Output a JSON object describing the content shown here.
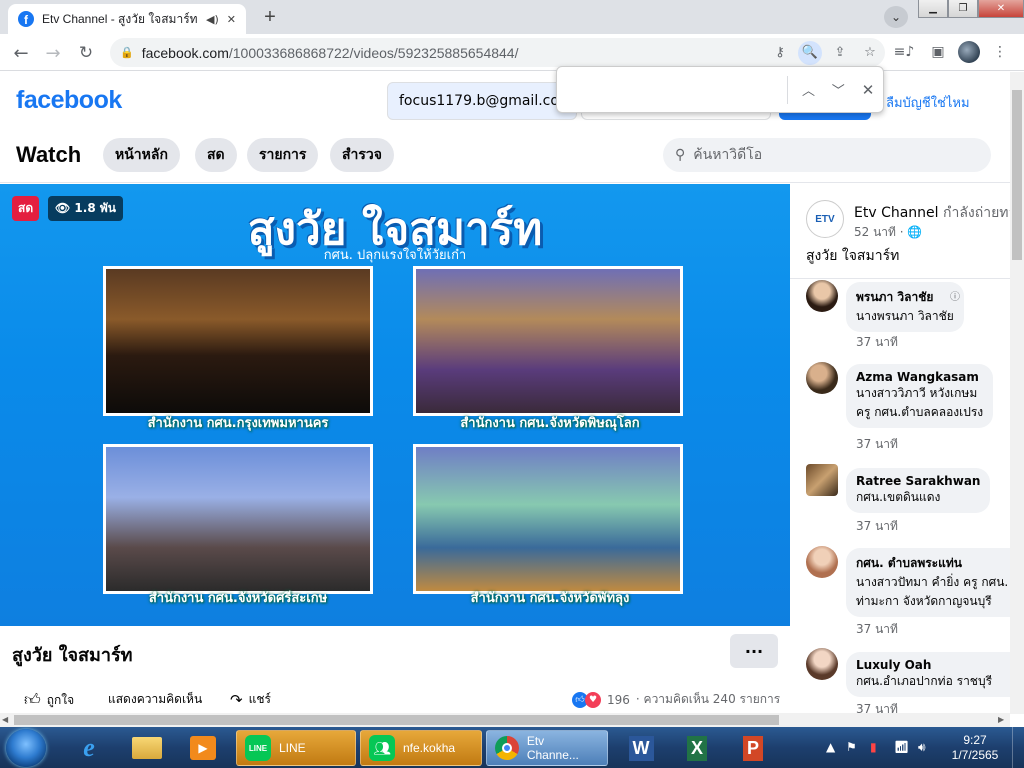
{
  "browser": {
    "tab_title": "Etv Channel - สูงวัย ใจสมาร์ท",
    "url_host": "facebook.com",
    "url_path": "/100033686868722/videos/592325885654844/",
    "find_value": ""
  },
  "fb": {
    "logo": "facebook",
    "email_value": "focus1179.b@gmail.com",
    "forgot_text": "ลืมบัญชีใช่ไหม"
  },
  "watch": {
    "title": "Watch",
    "tabs": [
      "หน้าหลัก",
      "สด",
      "รายการ",
      "สำรวจ"
    ],
    "search_placeholder": "ค้นหาวิดีโอ"
  },
  "video": {
    "live_badge": "สด",
    "views": "1.8 พัน",
    "banner_title": "สูงวัย ใจสมาร์ท",
    "banner_subtitle": "กศน. ปลุกแรงใจให้วัยเก๋า",
    "captions": [
      "สำนักงาน กศน.กรุงเทพมหานคร",
      "สำนักงาน กศน.จังหวัดพิษณุโลก",
      "สำนักงาน กศน.จังหวัดศรีสะเกษ",
      "สำนักงาน กศน.จังหวัดพัทลุง"
    ],
    "title": "สูงวัย ใจสมาร์ท",
    "more": "···",
    "like_label": "ถูกใจ",
    "comment_label": "แสดงความคิดเห็น",
    "share_label": "แชร์",
    "reaction_count": "196",
    "comment_count": "· ความคิดเห็น 240 รายการ"
  },
  "channel": {
    "logo_text": "ETV",
    "name": "Etv Channel",
    "status": "กำลังถ่ายทอดสด",
    "time": "52 นาที · 🌐",
    "description": "สูงวัย ใจสมาร์ท"
  },
  "comments": [
    {
      "name": "พรนภา วิลาชัย",
      "text": "นางพรนภา วิลาชัย",
      "text2": "",
      "time": "37 นาที"
    },
    {
      "name": "Azma Wangkasam",
      "text": "นางสาววิภาวี หวังเกษม",
      "text2": "ครู กศน.ตำบลคลองเปรง",
      "time": "37 นาที"
    },
    {
      "name": "Ratree Sarakhwan",
      "text": "กศน.เขตดินแดง",
      "text2": "",
      "time": "37 นาที"
    },
    {
      "name": "กศน. ตำบลพระแท่น",
      "text": "นางสาวปัทมา คำยิ่ง ครู กศน.",
      "text2": "ท่ามะกา จังหวัดกาญจนบุรี",
      "time": "37 นาที"
    },
    {
      "name": "Luxuly Oah",
      "text": "กศน.อำเภอปากท่อ ราชบุรี",
      "text2": "",
      "time": "37 นาที"
    }
  ],
  "taskbar": {
    "line_label": "LINE",
    "nfe_label": "nfe.kokha",
    "chrome_label": "Etv Channe...",
    "time": "9:27",
    "date": "1/7/2565"
  }
}
